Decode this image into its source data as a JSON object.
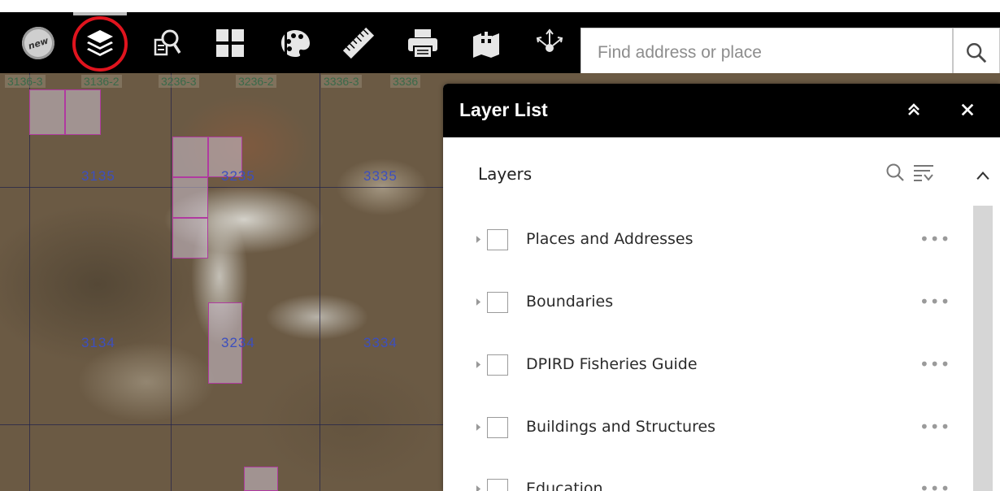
{
  "toolbar": {
    "new_badge_text": "new",
    "tools": [
      {
        "name": "what-is-new",
        "icon": "new-badge-icon"
      },
      {
        "name": "layer-list",
        "icon": "layers-icon",
        "active": true
      },
      {
        "name": "query",
        "icon": "search-document-icon"
      },
      {
        "name": "basemap-gallery",
        "icon": "grid-icon"
      },
      {
        "name": "draw",
        "icon": "palette-icon"
      },
      {
        "name": "measurement",
        "icon": "ruler-icon"
      },
      {
        "name": "print",
        "icon": "printer-icon"
      },
      {
        "name": "add-data",
        "icon": "add-data-icon"
      },
      {
        "name": "share",
        "icon": "share-icon"
      }
    ],
    "search": {
      "placeholder": "Find address or place",
      "value": ""
    }
  },
  "map": {
    "top_labels": [
      "3136-3",
      "3136-2",
      "3236-3",
      "3236-2",
      "3336-3",
      "3336"
    ],
    "tile_labels": [
      "3135",
      "3235",
      "3335",
      "3134",
      "3234",
      "3334"
    ]
  },
  "layer_panel": {
    "title": "Layer List",
    "heading": "Layers",
    "layers": [
      {
        "label": "Places and Addresses",
        "checked": false
      },
      {
        "label": "Boundaries",
        "checked": false
      },
      {
        "label": "DPIRD Fisheries Guide",
        "checked": false
      },
      {
        "label": "Buildings and Structures",
        "checked": false
      },
      {
        "label": "Education",
        "checked": false
      }
    ],
    "more_label": "•••"
  },
  "colors": {
    "toolbar_bg": "#000000",
    "highlight_ring": "#e0141e",
    "tile_label": "#3c4fbf",
    "scrollbar": "#d6d6d6"
  }
}
